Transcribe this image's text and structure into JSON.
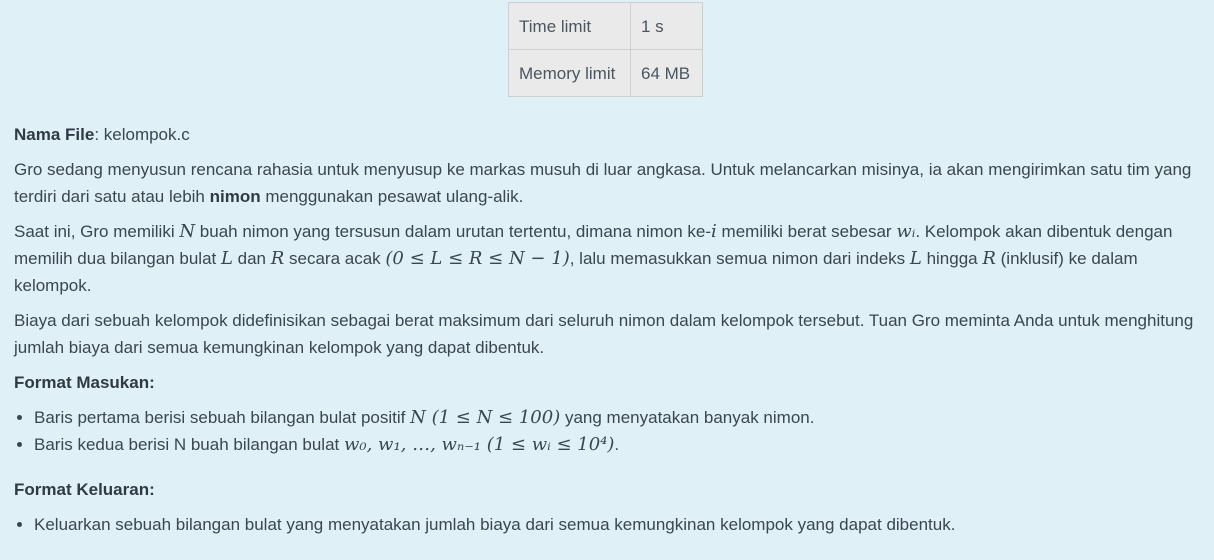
{
  "limits": {
    "time_label": "Time limit",
    "time_value": "1 s",
    "memory_label": "Memory limit",
    "memory_value": "64 MB"
  },
  "file": {
    "label": "Nama File",
    "name": ": kelompok.c"
  },
  "para1": {
    "a": "Gro sedang menyusun rencana rahasia untuk menyusup ke markas musuh di luar angkasa. Untuk melancarkan misinya, ia akan mengirimkan satu tim yang terdiri dari satu atau lebih ",
    "bold": "nimon",
    "b": " menggunakan pesawat ulang-alik."
  },
  "para2": {
    "t1": "Saat ini, Gro memiliki ",
    "m1": "N",
    "t2": " buah nimon yang tersusun dalam urutan tertentu, dimana nimon ke-",
    "m2": "i",
    "t3": " memiliki berat sebesar ",
    "m3": "wᵢ",
    "t4": ". Kelompok akan dibentuk dengan memilih dua bilangan bulat ",
    "m4": "L",
    "t5": " dan ",
    "m5": "R",
    "t6": " secara acak ",
    "m6": "(0 ≤ L ≤ R ≤ N − 1)",
    "t7": ", lalu memasukkan semua nimon dari indeks ",
    "m7": "L",
    "t8": " hingga ",
    "m8": "R",
    "t9": " (inklusif) ke dalam kelompok."
  },
  "para3": "Biaya dari sebuah kelompok didefinisikan sebagai berat maksimum dari seluruh nimon dalam kelompok tersebut. Tuan Gro meminta Anda untuk menghitung jumlah biaya dari semua kemungkinan kelompok yang dapat dibentuk.",
  "input_format": {
    "heading": "Format Masukan:",
    "item1": {
      "t1": "Baris pertama berisi sebuah bilangan bulat positif ",
      "m1": "N (1 ≤ N ≤ 100)",
      "t2": " yang menyatakan banyak nimon."
    },
    "item2": {
      "t1": "Baris kedua berisi N buah bilangan bulat ",
      "m1": "w₀, w₁, …, wₙ₋₁ (1 ≤ wᵢ ≤ 10⁴)",
      "t2": "."
    }
  },
  "output_format": {
    "heading": "Format Keluaran:",
    "item1": "Keluarkan sebuah bilangan bulat yang menyatakan jumlah biaya dari semua kemungkinan kelompok yang dapat dibentuk."
  }
}
